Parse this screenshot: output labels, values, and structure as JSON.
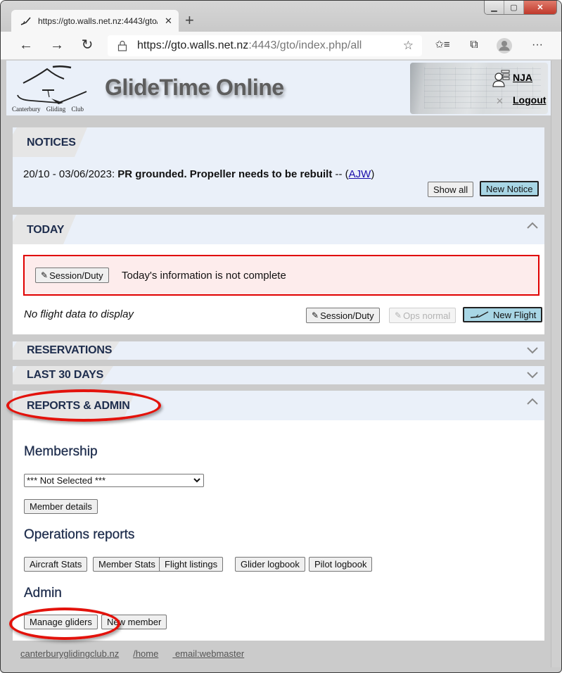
{
  "browser": {
    "tab_title": "https://gto.walls.net.nz:4443/gto/index.php/all",
    "tab_close": "✕",
    "new_tab": "+",
    "url_host": "https://gto.walls.net.nz",
    "url_rest": ":4443/gto/index.php/all",
    "back": "←",
    "forward": "→",
    "reload": "↻",
    "favorite": "☆",
    "favorites_list": "✩≡",
    "collections": "⧉",
    "more": "···",
    "window_controls": {
      "minimize": "▁",
      "maximize": "▢",
      "close": "✕"
    }
  },
  "header": {
    "logo_text": "Canterbury Gliding Club",
    "site_title": "GlideTime Online",
    "user": "NJA",
    "logout": "Logout"
  },
  "notices": {
    "title": "NOTICES",
    "date_range": "20/10 - 03/06/2023:",
    "message": "PR grounded. Propeller needs to be rebuilt",
    "separator": " -- (",
    "author": "AJW",
    "close_paren": ")",
    "show_all": "Show all",
    "new_notice": "New Notice"
  },
  "today": {
    "title": "TODAY",
    "alert_button": "Session/Duty",
    "alert_text": "Today's information is not complete",
    "no_data": "No flight data to display",
    "buttons": {
      "session_duty": "Session/Duty",
      "ops_normal": "Ops normal",
      "new_flight": "New Flight"
    }
  },
  "reservations": {
    "title": "RESERVATIONS"
  },
  "last30": {
    "title": "LAST 30 DAYS"
  },
  "reports": {
    "title": "REPORTS & ADMIN",
    "membership": {
      "heading": "Membership",
      "select_value": "*** Not Selected ***",
      "member_details": "Member details"
    },
    "operations": {
      "heading": "Operations reports",
      "buttons": [
        "Aircraft Stats",
        "Member Stats",
        "Flight listings",
        "Glider logbook",
        "Pilot logbook"
      ]
    },
    "admin": {
      "heading": "Admin",
      "buttons": [
        "Manage gliders",
        "New member"
      ]
    }
  },
  "footer": {
    "links": [
      "canterburyglidingclub.nz",
      "/home",
      " email:webmaster"
    ]
  },
  "annotations": {
    "color": "#e3120b",
    "highlighted": [
      "REPORTS & ADMIN",
      "Manage gliders"
    ]
  }
}
